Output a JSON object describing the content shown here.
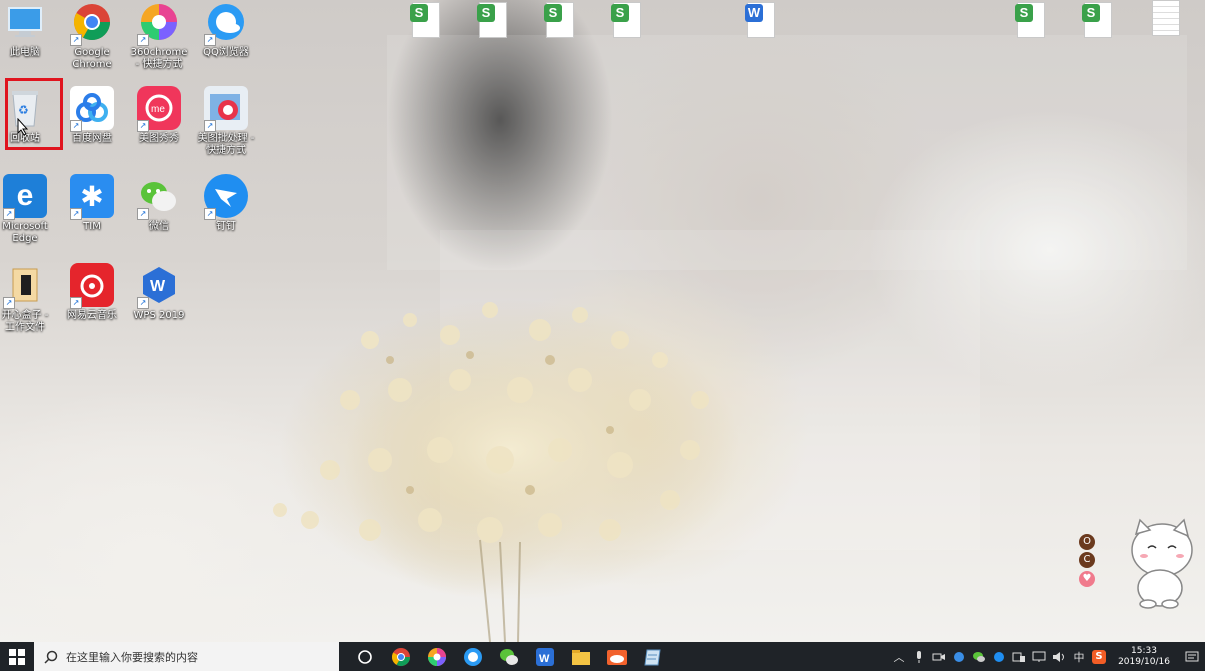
{
  "desktop_icons": [
    {
      "label": "此电脑"
    },
    {
      "label": "Google\nChrome"
    },
    {
      "label": "360chrome\n- 快捷方式"
    },
    {
      "label": "QQ浏览器"
    },
    {
      "label": "回收站"
    },
    {
      "label": "百度网盘"
    },
    {
      "label": "美图秀秀"
    },
    {
      "label": "美图批处理 -\n快捷方式"
    },
    {
      "label": "Microsoft\nEdge"
    },
    {
      "label": "TIM"
    },
    {
      "label": "微信"
    },
    {
      "label": "钉钉"
    },
    {
      "label": "开心盒子 -\n工作文件"
    },
    {
      "label": "网易云音乐"
    },
    {
      "label": "WPS 2019"
    }
  ],
  "file_badges": {
    "sheet": "S",
    "word": "W"
  },
  "widget": {
    "btn1": "O",
    "btn2": "C",
    "btn3": "♥"
  },
  "taskbar": {
    "search_placeholder": "在这里输入你要搜索的内容",
    "ime": "中",
    "time": "15:33",
    "date": "2019/10/16",
    "sogou": "S"
  },
  "colors": {
    "selection": "#e0141e",
    "taskbar": "#1f2328",
    "wps_sheet": "#3aa14a",
    "wps_word": "#2b6fd6"
  }
}
